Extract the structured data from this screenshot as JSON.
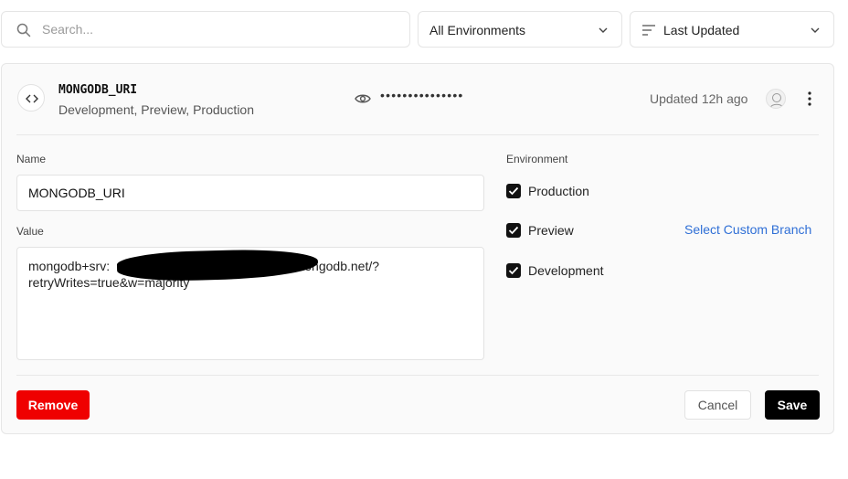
{
  "toolbar": {
    "search_placeholder": "Search...",
    "environment_filter": "All Environments",
    "sort": "Last Updated",
    "icons": {
      "search": "search-icon",
      "sort": "sort-lines-icon",
      "chevron": "chevron-down-icon"
    }
  },
  "variable": {
    "name": "MONGODB_URI",
    "environments_summary": "Development, Preview, Production",
    "masked_value": "•••••••••••••••",
    "updated": "Updated 12h ago",
    "icons": {
      "badge": "code-brackets-icon",
      "reveal": "eye-icon",
      "menu": "more-vertical-icon"
    }
  },
  "form": {
    "name_label": "Name",
    "name_value": "MONGODB_URI",
    "value_label": "Value",
    "value_text": "mongodb+srv:                                             x8o.mongodb.net/?retryWrites=true&w=majority",
    "environment_label": "Environment",
    "environments": [
      {
        "label": "Production",
        "checked": true
      },
      {
        "label": "Preview",
        "checked": true
      },
      {
        "label": "Development",
        "checked": true
      }
    ],
    "custom_branch_link": "Select Custom Branch"
  },
  "actions": {
    "remove": "Remove",
    "cancel": "Cancel",
    "save": "Save"
  },
  "colors": {
    "remove": "#ef0000",
    "save": "#000000",
    "link": "#2f6fd6",
    "card_background": "#fafafa"
  }
}
